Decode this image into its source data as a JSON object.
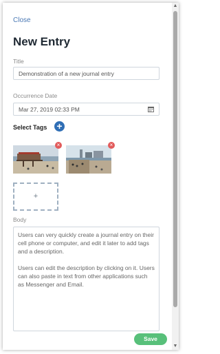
{
  "header": {
    "close_label": "Close",
    "title": "New Entry"
  },
  "form": {
    "title_label": "Title",
    "title_value": "Demonstration of a new journal entry",
    "date_label": "Occurrence Date",
    "date_value": "Mar 27, 2019 02:33 PM",
    "tags_label": "Select Tags",
    "add_tag_glyph": "+",
    "upload_glyph": "+",
    "remove_glyph": "×",
    "body_label": "Body",
    "body_paragraphs": [
      "Users can very quickly create a journal entry on their cell phone or computer, and edit it later to add tags and a description.",
      "Users can edit the description by clicking on it. Users can also paste in text from other applications such as Messenger and Email."
    ],
    "save_label": "Save"
  },
  "icons": {
    "calendar": "calendar-icon",
    "add_tag": "plus-circle-icon",
    "remove_photo": "close-circle-icon",
    "upload": "plus-icon"
  },
  "colors": {
    "link": "#4a78b4",
    "add_tag_button": "#2f6eb5",
    "remove_button": "#e25b5b",
    "save_button": "#58c07a"
  }
}
